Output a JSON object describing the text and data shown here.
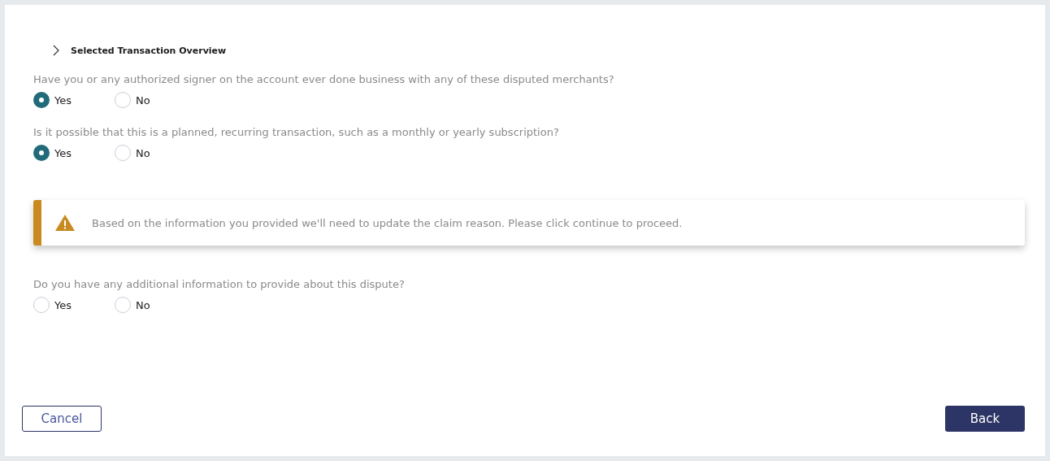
{
  "overview": {
    "title": "Selected Transaction Overview",
    "expanded": false
  },
  "sections": [
    {
      "kind": "question",
      "text": "Have you or any authorized signer on the account ever done business with any of these disputed merchants?",
      "options": [
        {
          "label": "Yes",
          "selected": true
        },
        {
          "label": "No",
          "selected": false
        }
      ]
    },
    {
      "kind": "question",
      "text": "Is it possible that this is a planned, recurring transaction, such as a monthly or yearly subscription?",
      "options": [
        {
          "label": "Yes",
          "selected": true
        },
        {
          "label": "No",
          "selected": false
        }
      ]
    },
    {
      "kind": "alert",
      "text": "Based on the information you provided we'll need to update the claim reason. Please click continue to proceed."
    },
    {
      "kind": "question",
      "text": "Do you have any additional information to provide about this dispute?",
      "options": [
        {
          "label": "Yes",
          "selected": false
        },
        {
          "label": "No",
          "selected": false
        }
      ]
    }
  ],
  "buttons": [
    {
      "label": "Cancel",
      "kind": "secondary"
    },
    {
      "label": "Back",
      "kind": "primary"
    }
  ]
}
